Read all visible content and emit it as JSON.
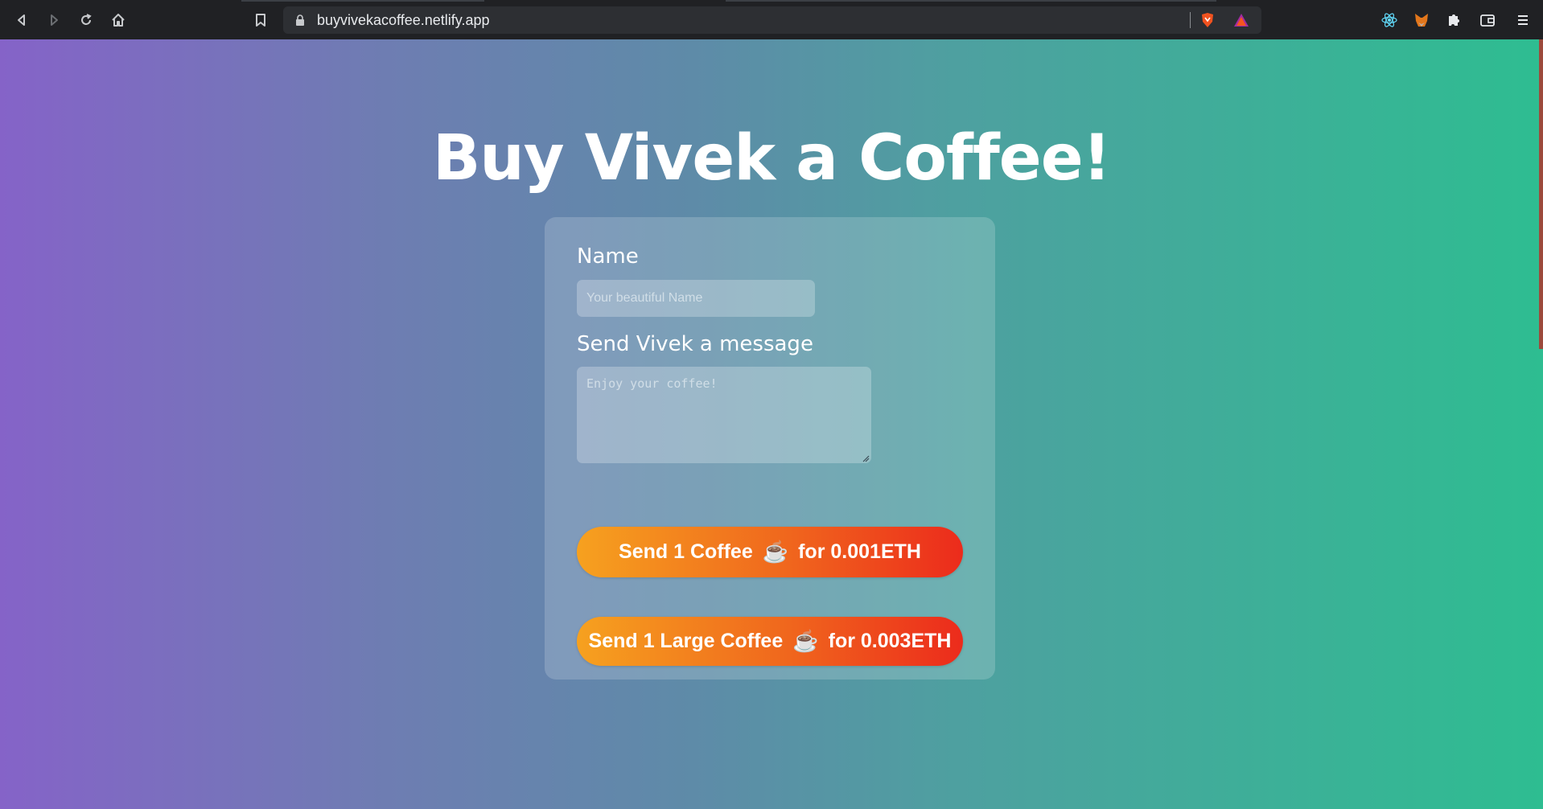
{
  "browser": {
    "url": "buyvivekacoffee.netlify.app",
    "icons": [
      "back-icon",
      "forward-icon",
      "reload-icon",
      "home-icon",
      "bookmark-icon",
      "lock-icon",
      "brave-shield-icon",
      "brave-rewards-icon",
      "react-devtools-icon",
      "metamask-icon",
      "extensions-icon",
      "wallet-icon",
      "menu-icon"
    ]
  },
  "page": {
    "title": "Buy Vivek a Coffee!",
    "form": {
      "name_label": "Name",
      "name_placeholder": "Your beautiful Name",
      "name_value": "",
      "message_label": "Send Vivek a message",
      "message_placeholder": "Enjoy your coffee!",
      "message_value": ""
    },
    "buttons": {
      "small": {
        "text_before": "Send 1 Coffee",
        "icon": "☕",
        "text_after": "for 0.001ETH"
      },
      "large": {
        "text_before": "Send 1 Large Coffee",
        "icon": "☕",
        "text_after": "for 0.003ETH"
      }
    }
  },
  "colors": {
    "gradient_start": "#8563c8",
    "gradient_end": "#2ebd91",
    "button_start": "#f6a11f",
    "button_end": "#ec2b1c"
  }
}
